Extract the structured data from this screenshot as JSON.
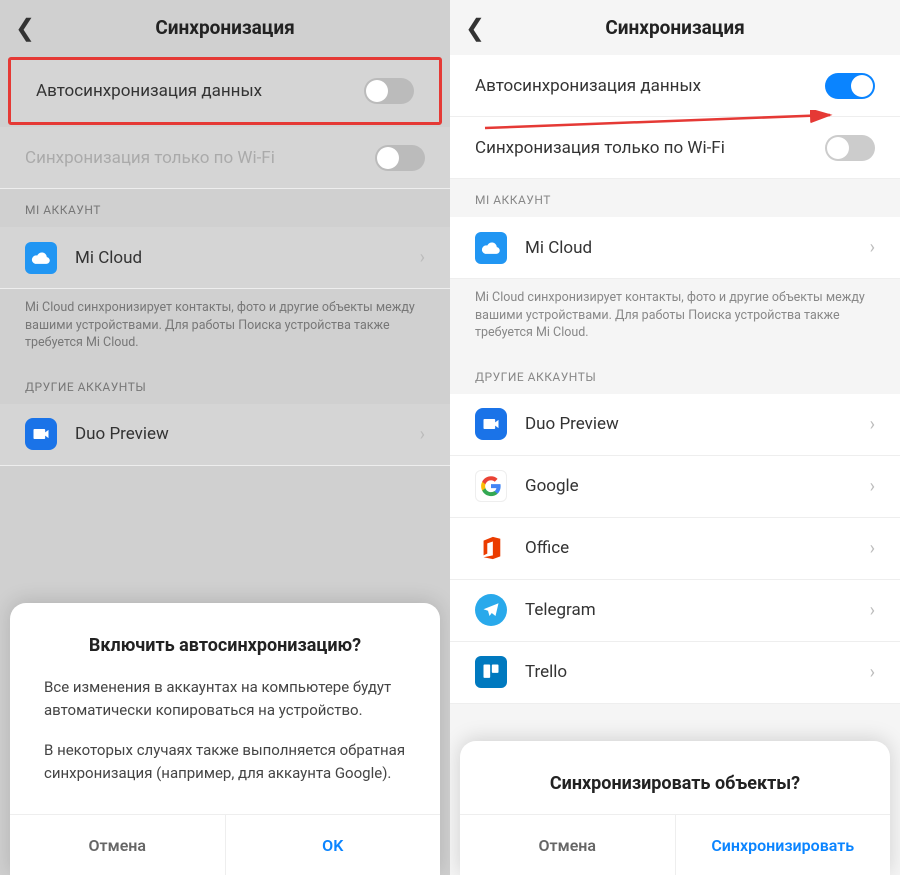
{
  "header": {
    "title": "Синхронизация"
  },
  "settings": {
    "autosync": "Автосинхронизация данных",
    "wifi_only": "Синхронизация только по Wi-Fi"
  },
  "sections": {
    "mi_account": "MI АККАУНТ",
    "other_accounts": "ДРУГИЕ АККАУНТЫ"
  },
  "accounts": {
    "micloud": "Mi Cloud",
    "duo": "Duo Preview",
    "google": "Google",
    "office": "Office",
    "telegram": "Telegram",
    "trello": "Trello"
  },
  "micloud_desc": "Mi Cloud синхронизирует контакты, фото и другие объекты между вашими устройствами. Для работы Поиска устройства также требуется Mi Cloud.",
  "dialog_left": {
    "title": "Включить автосинхронизацию?",
    "p1": "Все изменения в аккаунтах на компьютере будут автоматически копироваться на устройство.",
    "p2": "В некоторых случаях также выполняется обратная синхронизация (например, для аккаунта Google).",
    "cancel": "Отмена",
    "ok": "OK"
  },
  "dialog_right": {
    "title": "Синхронизировать объекты?",
    "cancel": "Отмена",
    "confirm": "Синхронизировать"
  }
}
